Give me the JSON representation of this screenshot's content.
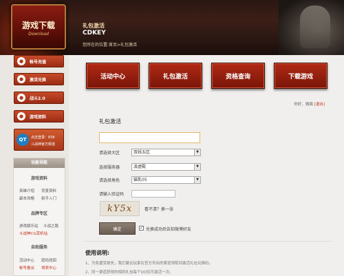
{
  "header": {
    "title": "礼包激活",
    "subtitle": "CDKEY",
    "breadcrumb": "您所在的位置:首页>礼包激活"
  },
  "logo": {
    "text": "游戏下载",
    "sub": "Download"
  },
  "sidebar": {
    "buttons": [
      {
        "label": "帐号充值",
        "icon": "user-icon",
        "glyph": "●"
      },
      {
        "label": "激活兑换",
        "icon": "gift-icon",
        "glyph": "●"
      },
      {
        "label": "战斗2.0",
        "icon": "battle-icon",
        "glyph": "●"
      },
      {
        "label": "游戏资料",
        "icon": "book-icon",
        "glyph": "●"
      }
    ],
    "qt": {
      "logo": "QT",
      "line1": "点击登录：838",
      "line2": "斗战神官方频道"
    },
    "nav": {
      "head": "功能导航",
      "sections": [
        {
          "title": "游戏资料",
          "links": [
            "英雄介绍",
            "背景资料",
            "副本攻略",
            "新手入门"
          ]
        },
        {
          "title": "品牌专区",
          "links": [
            "游戏娱乐站",
            "斗战之路",
            "斗战神CG赏析站"
          ]
        },
        {
          "title": "自助服务",
          "links": [
            "活动中心",
            "密码找回",
            "帐号看派",
            "领奖中心"
          ]
        }
      ]
    }
  },
  "main": {
    "big_buttons": [
      "活动中心",
      "礼包激活",
      "资格查询",
      "下载游戏"
    ],
    "user": {
      "greeting": "你好，",
      "name": "微面",
      "logout": "[退出]"
    },
    "form": {
      "title": "礼包激活",
      "cdk_value": "",
      "labels": [
        "请选择大区",
        "选择服务器",
        "请选择角色",
        "请输入验证码"
      ],
      "selects": [
        "双线五区",
        "凌虚殿",
        "猫乳05"
      ],
      "captcha_text": "kY5x",
      "refresh": "看不清？换一张",
      "confirm": "确定",
      "share_checked": true,
      "share_label": "兑换成功后告知微博好友"
    },
    "usage": {
      "title": "使用说明:",
      "lines": [
        "1、为免遭受损失，我们建议玩家在官方列出的渠道领取到激活礼包兑换码。",
        "2、同一渠道获得的相同礼包每个QQ仅可激活一次。"
      ]
    }
  }
}
